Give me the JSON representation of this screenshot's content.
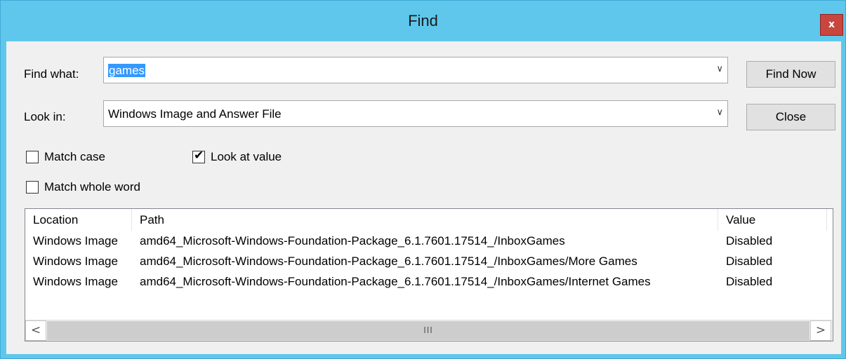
{
  "window": {
    "title": "Find",
    "close_glyph": "x"
  },
  "find_what": {
    "label": "Find what:",
    "value": "games"
  },
  "look_in": {
    "label": "Look in:",
    "value": "Windows Image and Answer File"
  },
  "buttons": {
    "find_now": "Find Now",
    "close": "Close"
  },
  "options": {
    "match_case": {
      "label": "Match case",
      "checked": false
    },
    "look_at_value": {
      "label": "Look at value",
      "checked": true
    },
    "match_whole_word": {
      "label": "Match whole word",
      "checked": false
    }
  },
  "results": {
    "columns": [
      "Location",
      "Path",
      "Value"
    ],
    "rows": [
      {
        "location": "Windows Image",
        "path": "amd64_Microsoft-Windows-Foundation-Package_6.1.7601.17514_/InboxGames",
        "value": "Disabled"
      },
      {
        "location": "Windows Image",
        "path": "amd64_Microsoft-Windows-Foundation-Package_6.1.7601.17514_/InboxGames/More Games",
        "value": "Disabled"
      },
      {
        "location": "Windows Image",
        "path": "amd64_Microsoft-Windows-Foundation-Package_6.1.7601.17514_/InboxGames/Internet Games",
        "value": "Disabled"
      }
    ]
  },
  "scrollbar": {
    "left_arrow": "<",
    "right_arrow": ">",
    "thumb_grip": "III"
  },
  "icons": {
    "dropdown": "chevron-down-icon",
    "check": "check-icon"
  },
  "colors": {
    "titlebar": "#5fc7ec",
    "close_button": "#c8463e",
    "selection": "#3399ff"
  }
}
